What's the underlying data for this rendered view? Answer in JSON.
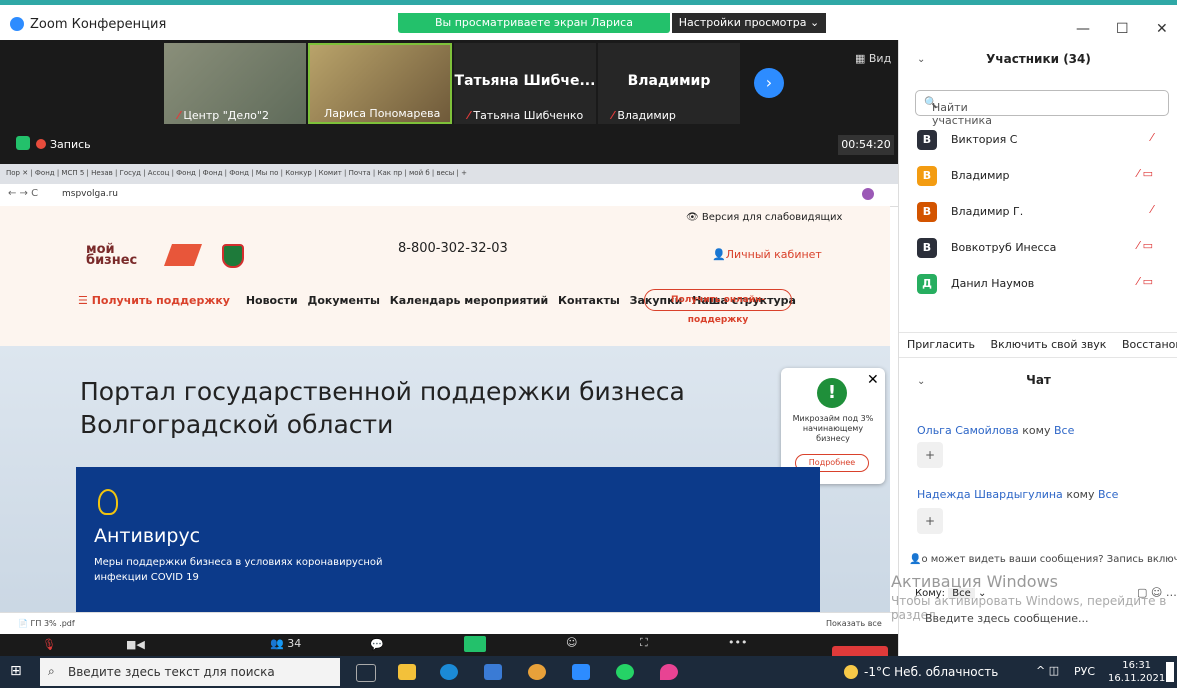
{
  "window": {
    "title": "Zoom Конференция"
  },
  "share": {
    "banner": "Вы просматриваете экран Лариса Пономарева",
    "view_settings": "Настройки просмотра ⌄"
  },
  "video_tiles": [
    {
      "name": "Центр \"Дело\"2"
    },
    {
      "name": "Лариса Пономарева"
    },
    {
      "title": "Татьяна Шибче...",
      "name": "Татьяна Шибченко"
    },
    {
      "title": "Владимир",
      "name": "Владимир"
    }
  ],
  "view_label": "Вид",
  "record_label": "Запись",
  "timer": "00:54:20",
  "browser": {
    "url": "mspvolga.ru",
    "tabs_text": "Пор ✕ | Фонд | МСП 5 | Незав | Госуд | Ассоц | Фонд | Фонд | Фонд | Мы по | Конкур | Комит | Почта | Как пр | мой б | весы | +",
    "accessible": "Версия для слабовидящих",
    "phone": "8-800-302-32-03",
    "cabinet": "Личный кабинет",
    "logo_line1": "мой",
    "logo_line2": "бизнес",
    "nav": [
      "Получить поддержку",
      "Новости",
      "Документы",
      "Календарь мероприятий",
      "Контакты",
      "Закупки",
      "Наша структура"
    ],
    "cta": "Получить онлайн-поддержку",
    "hero_title": "Портал государственной поддержки бизнеса Волгоградской области",
    "popup_text": "Микрозайм под 3% начинающему бизнесу",
    "popup_btn": "Подробнее",
    "antivirus_title": "Антивирус",
    "antivirus_sub": "Меры поддержки бизнеса в условиях коронавирусной инфекции COVID 19",
    "download_file": "ГП 3% .pdf",
    "show_all": "Показать все"
  },
  "controls": {
    "participants_count": "34"
  },
  "participants": {
    "header": "Участники (34)",
    "search_placeholder": "Найти участника",
    "list": [
      {
        "initial": "В",
        "name": "Виктория С",
        "color": "#2b2f3a"
      },
      {
        "initial": "В",
        "name": "Владимир",
        "color": "#f39c12"
      },
      {
        "initial": "В",
        "name": "Владимир Г.",
        "color": "#d35400"
      },
      {
        "initial": "В",
        "name": "Вовкотруб Инесса",
        "color": "#2b2f3a"
      },
      {
        "initial": "Д",
        "name": "Данил Наумов",
        "color": "#27ae60"
      }
    ],
    "actions": [
      "Пригласить",
      "Включить свой звук",
      "Восстановить ста"
    ]
  },
  "chat": {
    "header": "Чат",
    "messages": [
      {
        "from": "Ольга Самойлова",
        "to_word": "кому",
        "to": "Все"
      },
      {
        "from": "Надежда Швардыгулина",
        "to_word": "кому",
        "to": "Все"
      }
    ],
    "notice": "о может видеть ваши сообщения? Запись включе",
    "to_label": "Кому:",
    "to_value": "Все",
    "input_placeholder": "Введите здесь сообщение...",
    "activation_title": "Активация Windows",
    "activation_sub": "Чтобы активировать Windows, перейдите в раздел"
  },
  "taskbar": {
    "search": "Введите здесь текст для поиска",
    "weather": "-1°C Неб. облачность",
    "lang": "РУС",
    "time": "16:31",
    "date": "16.11.2021"
  }
}
